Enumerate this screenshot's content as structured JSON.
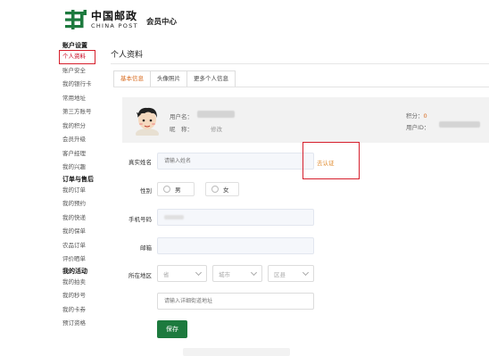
{
  "header": {
    "logo_cn": "中国邮政",
    "logo_en": "CHINA POST",
    "member_center": "会员中心"
  },
  "sidebar": {
    "groups": [
      {
        "title": "账户设置",
        "items": [
          "个人资料",
          "账户安全",
          "我的银行卡",
          "常用地址",
          "第三方账号",
          "我的积分",
          "会员升级",
          "客户经理",
          "我的兴趣"
        ]
      },
      {
        "title": "订单与售后",
        "items": [
          "我的订单",
          "我的预约",
          "我的快递",
          "我的保单",
          "农品订单",
          "评价晒单"
        ]
      },
      {
        "title": "我的活动",
        "items": [
          "我的拍卖",
          "我的秒号",
          "我的卡券",
          "预订资格"
        ]
      }
    ],
    "active_item": "个人资料"
  },
  "page": {
    "title": "个人资料",
    "tabs": [
      "基本信息",
      "头像照片",
      "更多个人信息"
    ],
    "active_tab": "基本信息"
  },
  "profile": {
    "username_label": "用户名：",
    "nickname_label": "昵　称：",
    "edit_label": "修改",
    "points_label": "积分：",
    "points_value": "0",
    "user_id_label": "用户ID："
  },
  "form": {
    "real_name_label": "真实姓名",
    "real_name_placeholder": "请输入姓名",
    "verify_label": "去认证",
    "gender_label": "性别",
    "gender_male": "男",
    "gender_female": "女",
    "phone_label": "手机号码",
    "email_label": "邮箱",
    "region_label": "所在地区",
    "province": "省",
    "city": "城市",
    "district": "区县",
    "address_placeholder": "请输入详细街道地址",
    "save_label": "保存"
  },
  "colors": {
    "brand_green": "#1d7a3e",
    "highlight_red": "#d61f2c",
    "accent_orange": "#d76a1f"
  }
}
